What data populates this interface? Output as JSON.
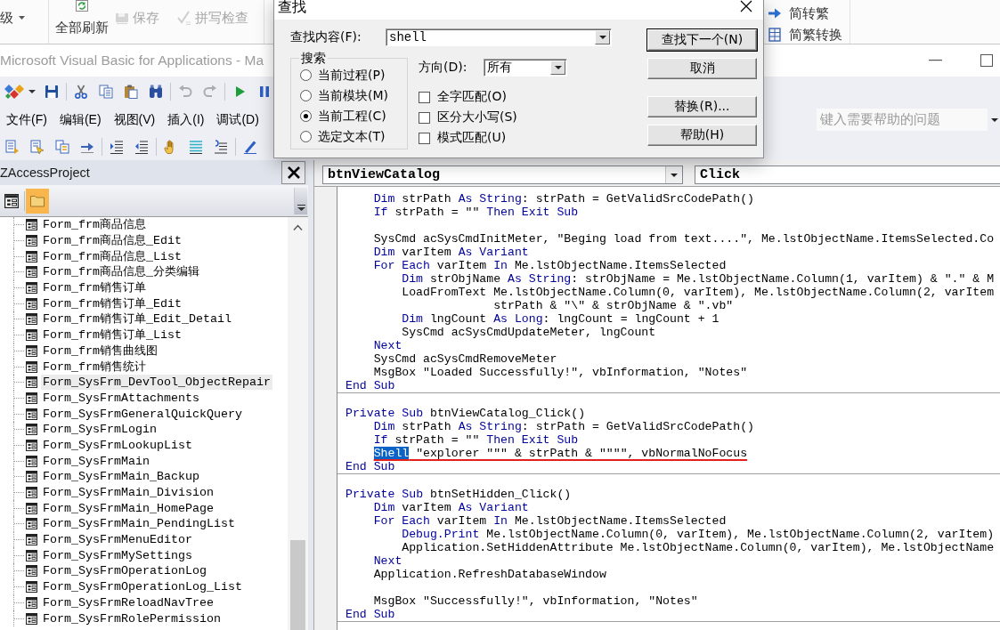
{
  "access_ribbon": {
    "dropdown": {
      "label": "级"
    },
    "refresh_button": {
      "label": "全部刷新"
    },
    "record_buttons": [
      {
        "kind": "save",
        "label": "保存",
        "disabled": true
      },
      {
        "kind": "spelling",
        "label": "拼写检查",
        "disabled": true
      }
    ],
    "convert_buttons": [
      {
        "kind": "to-traditional",
        "label": "简转繁"
      },
      {
        "kind": "convert",
        "label": "简繁转换"
      }
    ]
  },
  "vba_window": {
    "title": "Microsoft Visual Basic for Applications - Ma",
    "toolbar": [
      {
        "buttons": [
          {
            "kind": "insert",
            "disabled": false
          },
          {
            "kind": "save",
            "disabled": false
          }
        ]
      },
      {
        "buttons": [
          {
            "kind": "cut",
            "disabled": false
          },
          {
            "kind": "copy",
            "disabled": false
          },
          {
            "kind": "paste",
            "disabled": false
          },
          {
            "kind": "find",
            "disabled": false
          }
        ]
      },
      {
        "buttons": [
          {
            "kind": "undo",
            "disabled": true
          },
          {
            "kind": "redo",
            "disabled": true
          }
        ]
      },
      {
        "buttons": [
          {
            "kind": "run",
            "disabled": false
          },
          {
            "kind": "pause",
            "disabled": false
          }
        ]
      }
    ],
    "menu": [
      "文件(F)",
      "编辑(E)",
      "视图(V)",
      "插入(I)",
      "调试(D)"
    ],
    "help_search": {
      "placeholder": "键入需要帮助的问题"
    },
    "edit_toolbar": [
      {
        "buttons": [
          {
            "kind": "list-members"
          },
          {
            "kind": "list-constants"
          },
          {
            "kind": "quick-info"
          },
          {
            "kind": "complete-word"
          }
        ]
      },
      {
        "buttons": [
          {
            "kind": "indent"
          },
          {
            "kind": "outdent"
          }
        ]
      },
      {
        "buttons": [
          {
            "kind": "breakpoint"
          },
          {
            "kind": "comment"
          },
          {
            "kind": "uncomment"
          }
        ]
      },
      {
        "buttons": [
          {
            "kind": "bookmark"
          }
        ]
      }
    ]
  },
  "project_explorer": {
    "title": "ZAccessProject",
    "toolbar": [
      {
        "kind": "view-object",
        "on": false
      },
      {
        "kind": "toggle-folders",
        "on": true
      }
    ],
    "items": [
      {
        "label": "Form_frm商品信息",
        "selected": false
      },
      {
        "label": "Form_frm商品信息_Edit",
        "selected": false
      },
      {
        "label": "Form_frm商品信息_List",
        "selected": false
      },
      {
        "label": "Form_frm商品信息_分类编辑",
        "selected": false
      },
      {
        "label": "Form_frm销售订单",
        "selected": false
      },
      {
        "label": "Form_frm销售订单_Edit",
        "selected": false
      },
      {
        "label": "Form_frm销售订单_Edit_Detail",
        "selected": false
      },
      {
        "label": "Form_frm销售订单_List",
        "selected": false
      },
      {
        "label": "Form_frm销售曲线图",
        "selected": false
      },
      {
        "label": "Form_frm销售统计",
        "selected": false
      },
      {
        "label": "Form_SysFrm_DevTool_ObjectRepair",
        "selected": true
      },
      {
        "label": "Form_SysFrmAttachments",
        "selected": false
      },
      {
        "label": "Form_SysFrmGeneralQuickQuery",
        "selected": false
      },
      {
        "label": "Form_SysFrmLogin",
        "selected": false
      },
      {
        "label": "Form_SysFrmLookupList",
        "selected": false
      },
      {
        "label": "Form_SysFrmMain",
        "selected": false
      },
      {
        "label": "Form_SysFrmMain_Backup",
        "selected": false
      },
      {
        "label": "Form_SysFrmMain_Division",
        "selected": false
      },
      {
        "label": "Form_SysFrmMain_HomePage",
        "selected": false
      },
      {
        "label": "Form_SysFrmMain_PendingList",
        "selected": false
      },
      {
        "label": "Form_SysFrmMenuEditor",
        "selected": false
      },
      {
        "label": "Form_SysFrmMySettings",
        "selected": false
      },
      {
        "label": "Form_SysFrmOperationLog",
        "selected": false
      },
      {
        "label": "Form_SysFrmOperationLog_List",
        "selected": false
      },
      {
        "label": "Form_SysFrmReloadNavTree",
        "selected": false
      },
      {
        "label": "Form_SysFrmRolePermission",
        "selected": false
      }
    ]
  },
  "code_window": {
    "object": "btnViewCatalog",
    "procedure": "Click",
    "procedures": [
      {
        "lines": [
          {
            "kind": "code",
            "segments": [
              {
                "kind": "keyword",
                "text": "    Dim"
              },
              {
                "kind": "plain",
                "text": " strPath "
              },
              {
                "kind": "keyword",
                "text": "As String"
              },
              {
                "kind": "plain",
                "text": ": strPath = GetValidSrcCodePath()"
              }
            ]
          },
          {
            "kind": "code",
            "segments": [
              {
                "kind": "keyword",
                "text": "    If"
              },
              {
                "kind": "plain",
                "text": " strPath = \"\" "
              },
              {
                "kind": "keyword",
                "text": "Then Exit Sub"
              }
            ]
          },
          {
            "kind": "blank"
          },
          {
            "kind": "code",
            "segments": [
              {
                "kind": "plain",
                "text": "    SysCmd acSysCmdInitMeter, \"Beging load from text....\", Me.lstObjectName.ItemsSelected.Co"
              }
            ]
          },
          {
            "kind": "code",
            "segments": [
              {
                "kind": "keyword",
                "text": "    Dim"
              },
              {
                "kind": "plain",
                "text": " varItem "
              },
              {
                "kind": "keyword",
                "text": "As Variant"
              }
            ]
          },
          {
            "kind": "code",
            "segments": [
              {
                "kind": "keyword",
                "text": "    For Each"
              },
              {
                "kind": "plain",
                "text": " varItem "
              },
              {
                "kind": "keyword",
                "text": "In"
              },
              {
                "kind": "plain",
                "text": " Me.lstObjectName.ItemsSelected"
              }
            ]
          },
          {
            "kind": "code",
            "segments": [
              {
                "kind": "keyword",
                "text": "        Dim"
              },
              {
                "kind": "plain",
                "text": " strObjName "
              },
              {
                "kind": "keyword",
                "text": "As String"
              },
              {
                "kind": "plain",
                "text": ": strObjName = Me.lstObjectName.Column(1, varItem) & \".\" & M"
              }
            ]
          },
          {
            "kind": "code",
            "segments": [
              {
                "kind": "plain",
                "text": "        LoadFromText Me.lstObjectName.Column(0, varItem), Me.lstObjectName.Column(2, varItem"
              }
            ]
          },
          {
            "kind": "code",
            "segments": [
              {
                "kind": "plain",
                "text": "                     strPath & \"\\\" & strObjName & \".vb\""
              }
            ]
          },
          {
            "kind": "code",
            "segments": [
              {
                "kind": "keyword",
                "text": "        Dim"
              },
              {
                "kind": "plain",
                "text": " lngCount "
              },
              {
                "kind": "keyword",
                "text": "As Long"
              },
              {
                "kind": "plain",
                "text": ": lngCount = lngCount + 1"
              }
            ]
          },
          {
            "kind": "code",
            "segments": [
              {
                "kind": "plain",
                "text": "        SysCmd acSysCmdUpdateMeter, lngCount"
              }
            ]
          },
          {
            "kind": "code",
            "segments": [
              {
                "kind": "keyword",
                "text": "    Next"
              }
            ]
          },
          {
            "kind": "code",
            "segments": [
              {
                "kind": "plain",
                "text": "    SysCmd acSysCmdRemoveMeter"
              }
            ]
          },
          {
            "kind": "code",
            "segments": [
              {
                "kind": "plain",
                "text": "    MsgBox \"Loaded Successfully!\", vbInformation, \"Notes\""
              }
            ]
          },
          {
            "kind": "code",
            "segments": [
              {
                "kind": "keyword",
                "text": "End Sub"
              }
            ]
          }
        ]
      },
      {
        "lines": [
          {
            "kind": "blank"
          },
          {
            "kind": "code",
            "segments": [
              {
                "kind": "keyword",
                "text": "Private Sub"
              },
              {
                "kind": "plain",
                "text": " btnViewCatalog_Click()"
              }
            ]
          },
          {
            "kind": "code",
            "segments": [
              {
                "kind": "keyword",
                "text": "    Dim"
              },
              {
                "kind": "plain",
                "text": " strPath "
              },
              {
                "kind": "keyword",
                "text": "As String"
              },
              {
                "kind": "plain",
                "text": ": strPath = GetValidSrcCodePath()"
              }
            ]
          },
          {
            "kind": "code",
            "segments": [
              {
                "kind": "keyword",
                "text": "    If"
              },
              {
                "kind": "plain",
                "text": " strPath = \"\" "
              },
              {
                "kind": "keyword",
                "text": "Then Exit Sub"
              }
            ]
          },
          {
            "kind": "underlined",
            "segments": [
              {
                "kind": "selected",
                "text": "    Shell"
              },
              {
                "kind": "plain",
                "text": " \"explorer \"\"\" & strPath & \"\"\"\", vbNormalNoFocus"
              }
            ]
          },
          {
            "kind": "code",
            "segments": [
              {
                "kind": "keyword",
                "text": "End Sub"
              }
            ]
          }
        ]
      },
      {
        "lines": [
          {
            "kind": "blank"
          },
          {
            "kind": "code",
            "segments": [
              {
                "kind": "keyword",
                "text": "Private Sub"
              },
              {
                "kind": "plain",
                "text": " btnSetHidden_Click()"
              }
            ]
          },
          {
            "kind": "code",
            "segments": [
              {
                "kind": "keyword",
                "text": "    Dim"
              },
              {
                "kind": "plain",
                "text": " varItem "
              },
              {
                "kind": "keyword",
                "text": "As Variant"
              }
            ]
          },
          {
            "kind": "code",
            "segments": [
              {
                "kind": "keyword",
                "text": "    For Each"
              },
              {
                "kind": "plain",
                "text": " varItem "
              },
              {
                "kind": "keyword",
                "text": "In"
              },
              {
                "kind": "plain",
                "text": " Me.lstObjectName.ItemsSelected"
              }
            ]
          },
          {
            "kind": "code",
            "segments": [
              {
                "kind": "keyword",
                "text": "        Debug.Print"
              },
              {
                "kind": "plain",
                "text": " Me.lstObjectName.Column(0, varItem), Me.lstObjectName.Column(2, varItem)"
              }
            ]
          },
          {
            "kind": "code",
            "segments": [
              {
                "kind": "plain",
                "text": "        Application.SetHiddenAttribute Me.lstObjectName.Column(0, varItem), Me.lstObjectName"
              }
            ]
          },
          {
            "kind": "code",
            "segments": [
              {
                "kind": "keyword",
                "text": "    Next"
              }
            ]
          },
          {
            "kind": "code",
            "segments": [
              {
                "kind": "plain",
                "text": "    Application.RefreshDatabaseWindow"
              }
            ]
          },
          {
            "kind": "blank"
          },
          {
            "kind": "code",
            "segments": [
              {
                "kind": "plain",
                "text": "    MsgBox \"Successfully!\", vbInformation, \"Notes\""
              }
            ]
          },
          {
            "kind": "code",
            "segments": [
              {
                "kind": "keyword",
                "text": "End Sub"
              }
            ]
          }
        ]
      }
    ]
  },
  "find_dialog": {
    "title": "查找",
    "find_what": {
      "label": "查找内容(F):",
      "value": "shell"
    },
    "scope": {
      "title": "搜索",
      "options": [
        {
          "label": "当前过程(P)",
          "selected": false
        },
        {
          "label": "当前模块(M)",
          "selected": false
        },
        {
          "label": "当前工程(C)",
          "selected": true
        },
        {
          "label": "选定文本(T)",
          "selected": false
        }
      ]
    },
    "direction": {
      "label": "方向(D):",
      "value": "所有"
    },
    "match_options": [
      {
        "label": "全字匹配(O)",
        "checked": false
      },
      {
        "label": "区分大小写(S)",
        "checked": false
      },
      {
        "label": "模式匹配(U)",
        "checked": false
      }
    ],
    "buttons": [
      {
        "label": "查找下一个(N)",
        "default": true
      },
      {
        "label": "取消",
        "default": false
      },
      {
        "label": "替换(R)...",
        "default": false
      },
      {
        "label": "帮助(H)",
        "default": false
      }
    ]
  }
}
